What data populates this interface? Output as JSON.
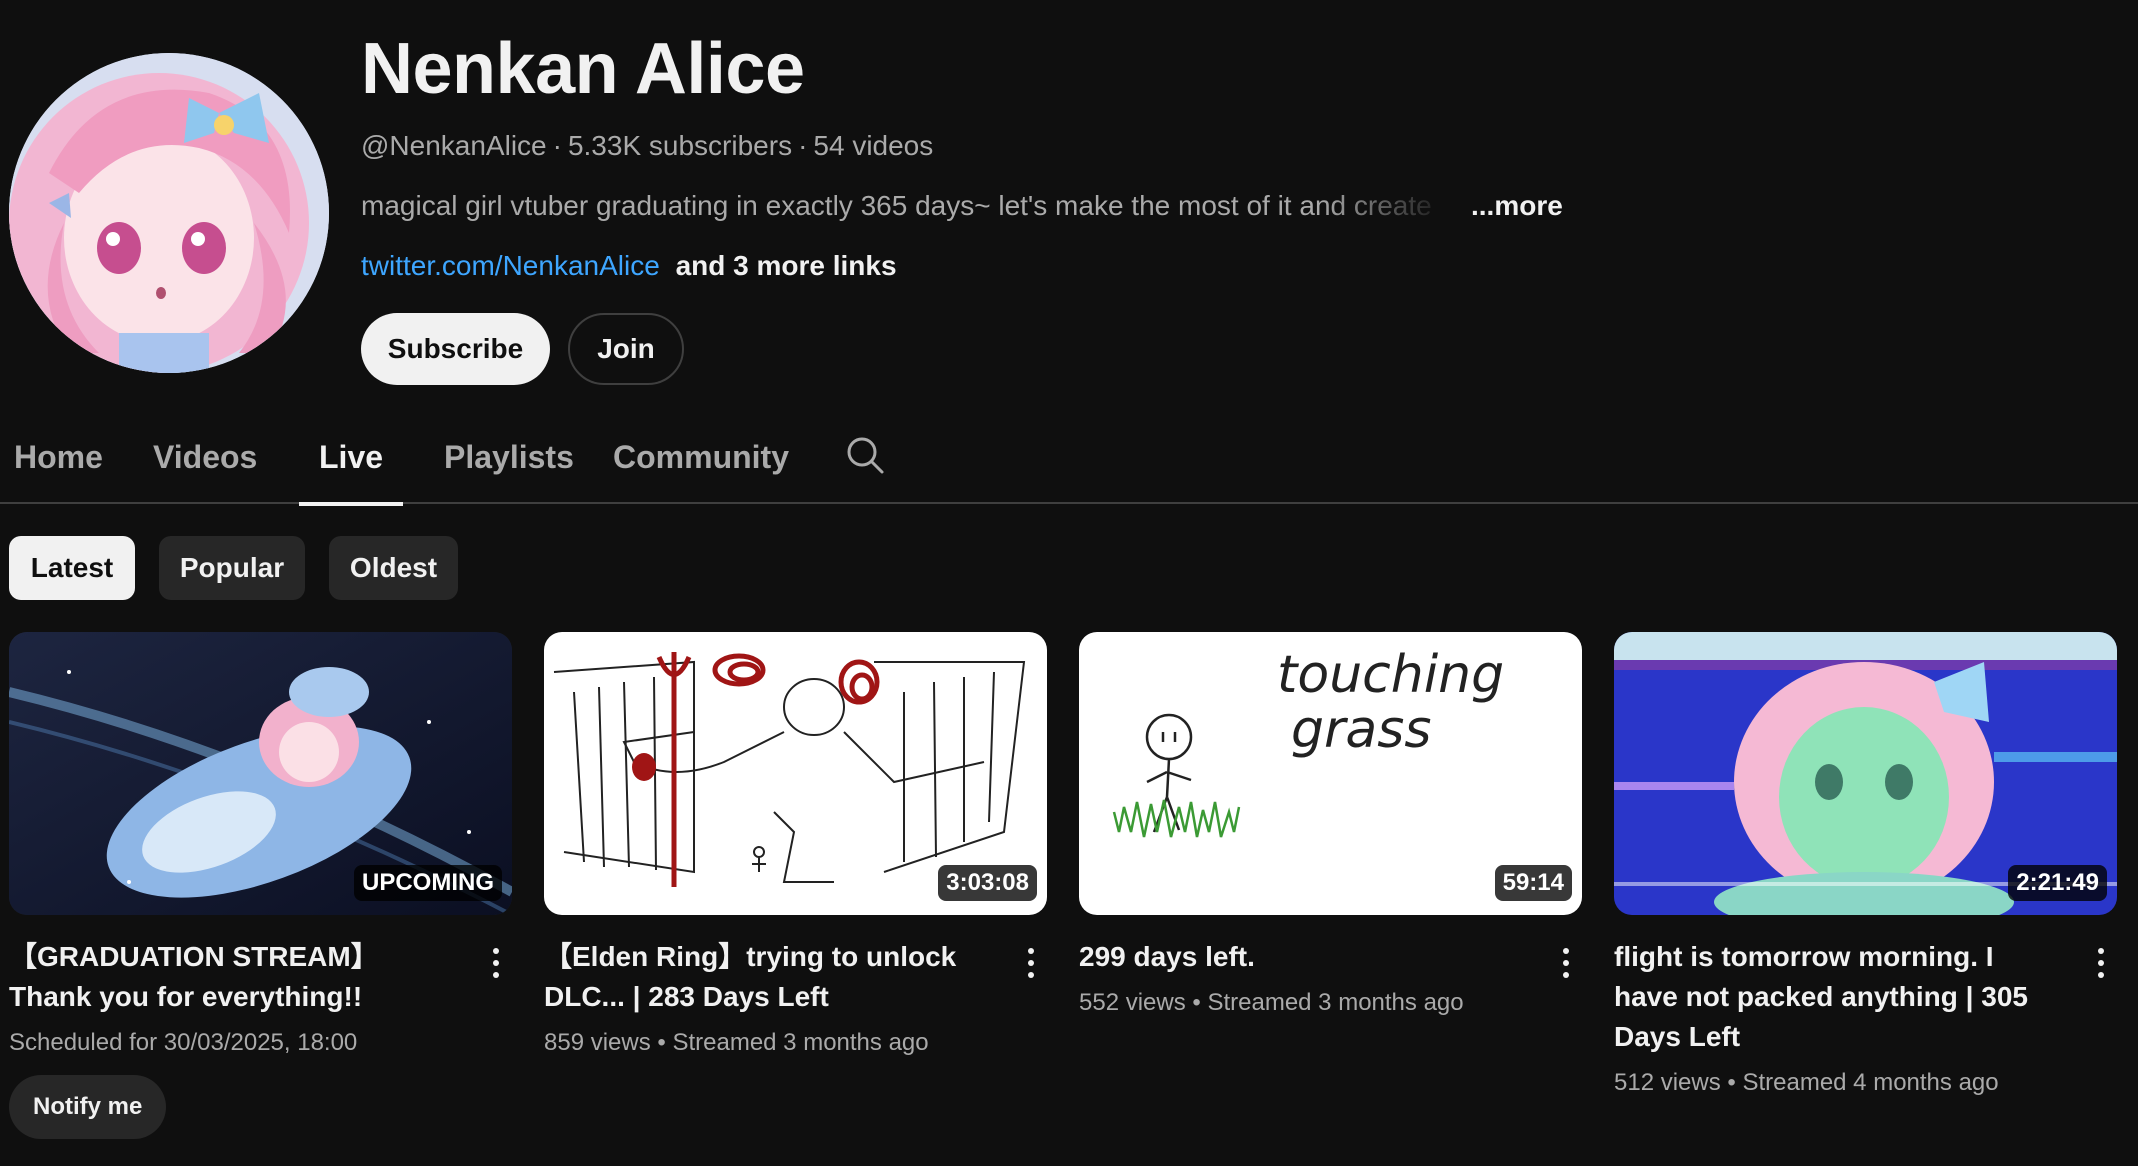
{
  "channel": {
    "name": "Nenkan Alice",
    "handle": "@NenkanAlice",
    "subscribers": "5.33K subscribers",
    "videos": "54 videos",
    "description": "magical girl vtuber graduating in exactly 365 days~ let's make the most of it and create",
    "more_label": "...more",
    "link": "twitter.com/NenkanAlice",
    "more_links": "and 3 more links",
    "subscribe_label": "Subscribe",
    "join_label": "Join"
  },
  "tabs": [
    {
      "label": "Home"
    },
    {
      "label": "Videos"
    },
    {
      "label": "Live",
      "active": true
    },
    {
      "label": "Playlists"
    },
    {
      "label": "Community"
    }
  ],
  "chips": [
    {
      "label": "Latest",
      "active": true
    },
    {
      "label": "Popular"
    },
    {
      "label": "Oldest"
    }
  ],
  "videos": [
    {
      "title": "【GRADUATION STREAM】Thank you for everything!!",
      "badge": "UPCOMING",
      "meta": "Scheduled for 30/03/2025, 18:00",
      "action": "Notify me"
    },
    {
      "title": "【Elden Ring】trying to unlock DLC... | 283 Days Left",
      "badge": "3:03:08",
      "meta": "859 views • Streamed 3 months ago"
    },
    {
      "title": "299 days left.",
      "badge": "59:14",
      "meta": "552 views • Streamed 3 months ago",
      "thumb_text": [
        "touching",
        "grass"
      ]
    },
    {
      "title": "flight is tomorrow morning. I have not packed anything | 305 Days Left",
      "badge": "2:21:49",
      "meta": "512 views • Streamed 4 months ago"
    }
  ],
  "colors": {
    "background": "#0f0f0f",
    "link": "#3ea6ff",
    "chip": "#272727"
  }
}
